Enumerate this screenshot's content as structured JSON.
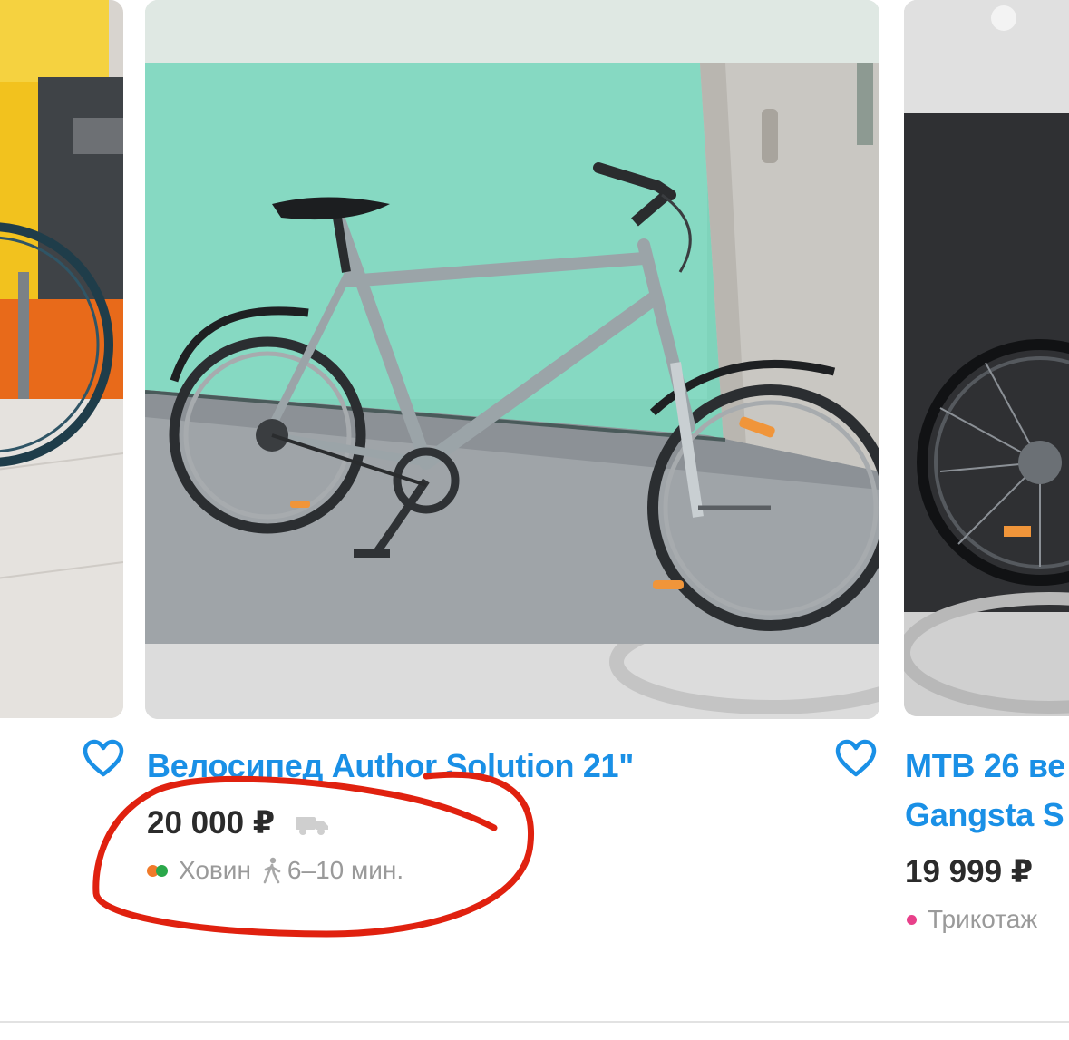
{
  "colors": {
    "link": "#1a90e6",
    "price": "#2b2b2b",
    "muted": "#9a9a9a",
    "annotation": "#e0210f",
    "metro_orange": "#f07a2a",
    "metro_green": "#2aa84a",
    "metro_pink": "#e8408a"
  },
  "listings": [
    {
      "title": "",
      "price": "",
      "location": ""
    },
    {
      "title": "Велосипед Author Solution 21\"",
      "price": "20 000 ₽",
      "metro_station": "Ховин",
      "walk_time": "6–10 мин.",
      "favorite_icon": "heart-icon",
      "delivery_icon": "truck-icon",
      "walk_icon": "walking-person-icon"
    },
    {
      "title_line1": "MTB 26 ве",
      "title_line2": "Gangsta S",
      "price": "19 999 ₽",
      "metro_station": "Трикотаж",
      "favorite_icon": "heart-icon"
    }
  ]
}
